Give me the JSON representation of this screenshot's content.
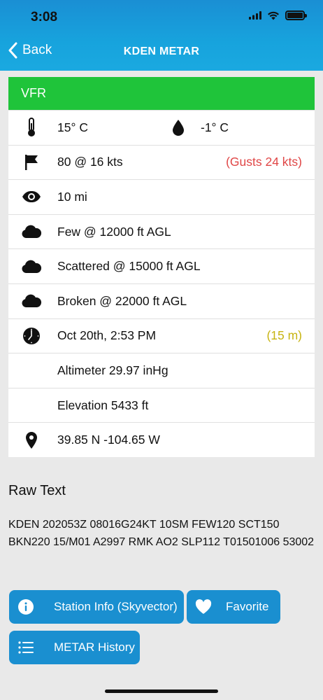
{
  "status_bar": {
    "time": "3:08"
  },
  "nav": {
    "back_label": "Back",
    "title": "KDEN METAR"
  },
  "flight_rule": {
    "label": "VFR",
    "color": "#1fc43a"
  },
  "rows": {
    "temperature": "15° C",
    "dewpoint": "-1° C",
    "wind": "80 @ 16 kts",
    "gusts": "(Gusts 24 kts)",
    "visibility": "10 mi",
    "clouds": [
      "Few @ 12000 ft AGL",
      "Scattered @ 15000 ft AGL",
      "Broken @ 22000 ft AGL"
    ],
    "time": "Oct 20th, 2:53 PM",
    "age": "(15 m)",
    "altimeter": "Altimeter 29.97 inHg",
    "elevation": "Elevation 5433 ft",
    "location": "39.85 N -104.65 W"
  },
  "raw": {
    "title": "Raw Text",
    "text": "KDEN 202053Z 08016G24KT 10SM FEW120 SCT150 BKN220 15/M01 A2997 RMK AO2 SLP112 T01501006 53002"
  },
  "buttons": {
    "station_info": "Station Info (Skyvector)",
    "favorite": "Favorite",
    "history": "METAR History"
  },
  "colors": {
    "header": "#1a9fdc",
    "button": "#1a8fd0",
    "gusts": "#e04646",
    "age": "#c7b412"
  },
  "icons": [
    "thermometer-icon",
    "droplet-icon",
    "flag-icon",
    "eye-icon",
    "cloud-icon",
    "clock-icon",
    "location-pin-icon",
    "info-icon",
    "heart-icon",
    "list-icon",
    "back-chevron-icon",
    "wifi-icon",
    "battery-icon",
    "signal-icon"
  ]
}
